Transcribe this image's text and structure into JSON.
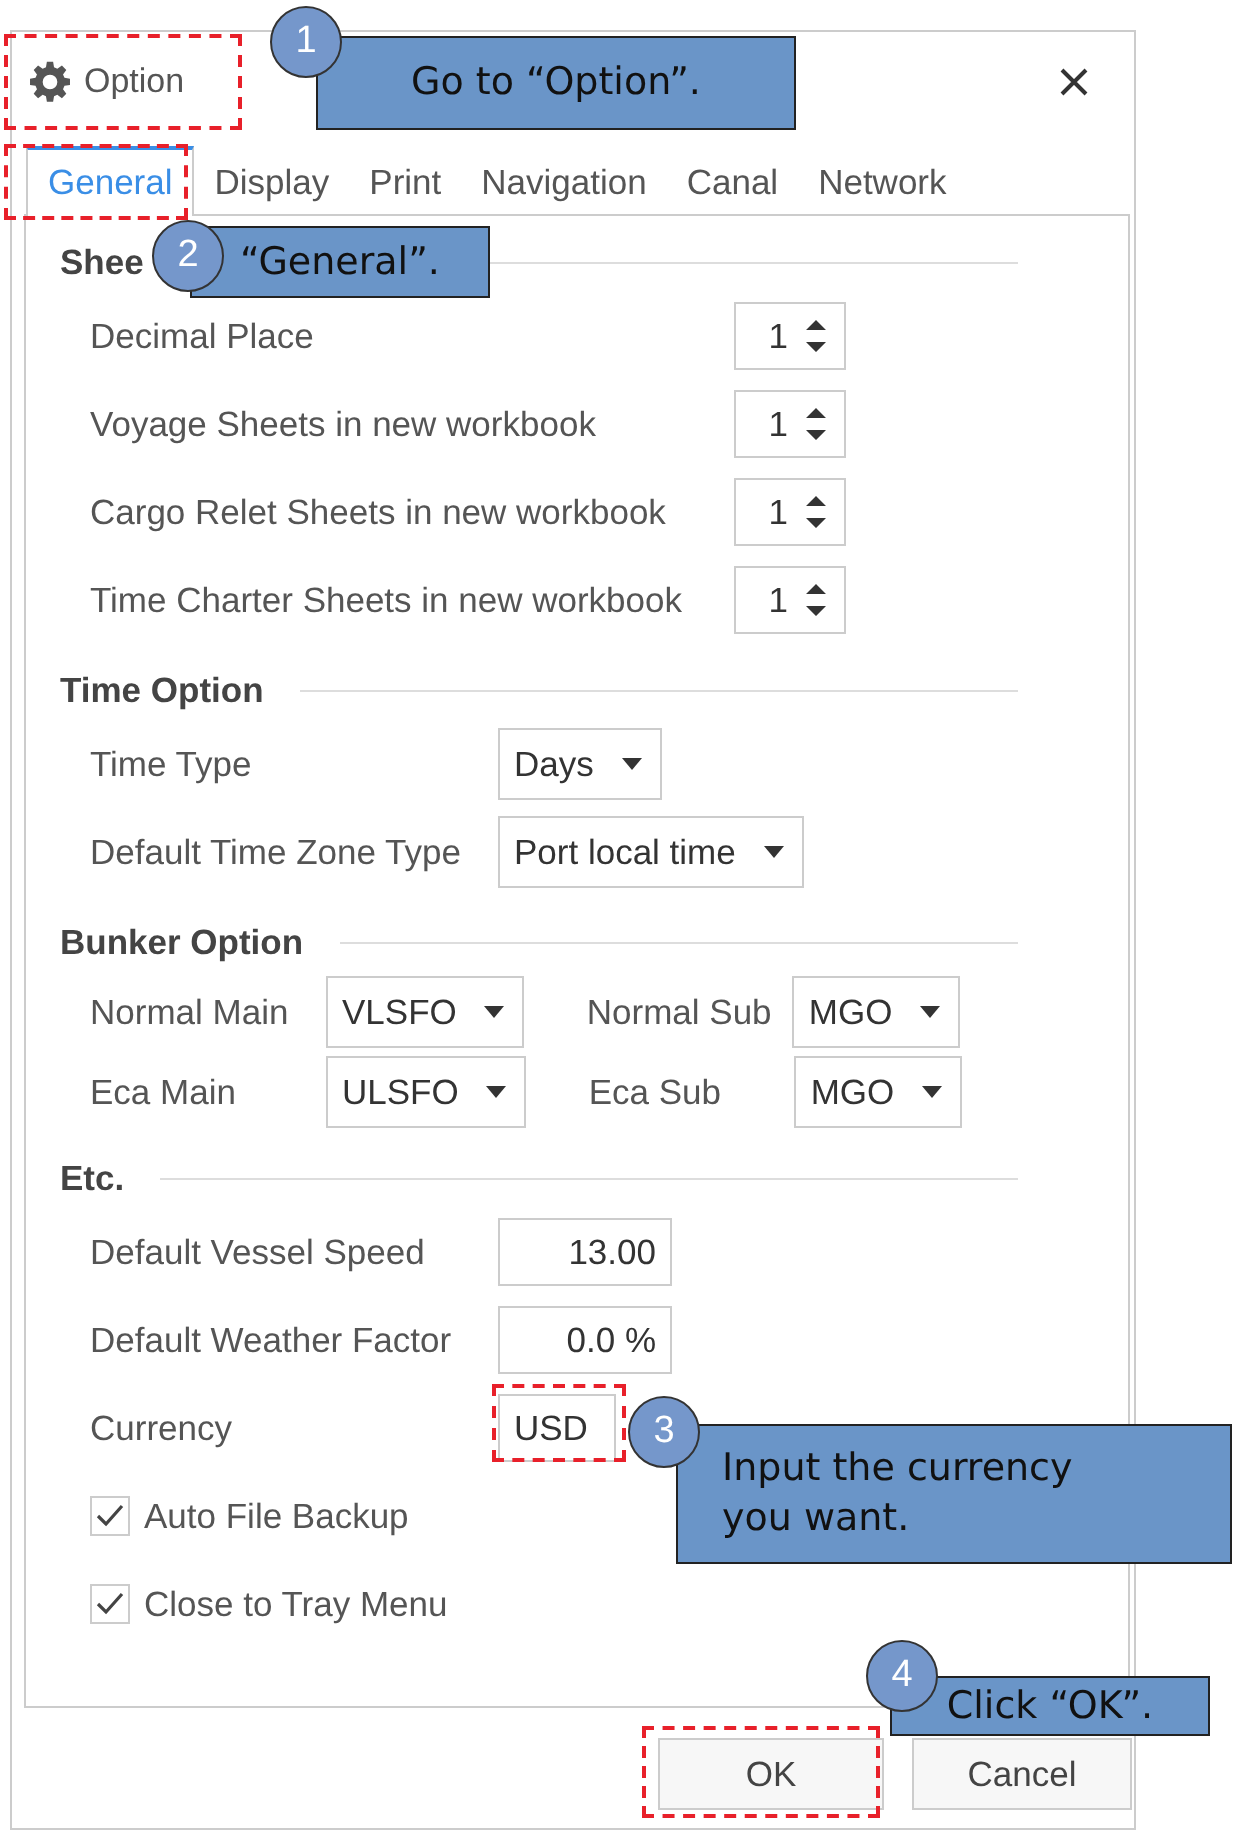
{
  "window": {
    "title": "Option"
  },
  "tabs": [
    {
      "label": "General",
      "selected": true
    },
    {
      "label": "Display",
      "selected": false
    },
    {
      "label": "Print",
      "selected": false
    },
    {
      "label": "Navigation",
      "selected": false
    },
    {
      "label": "Canal",
      "selected": false
    },
    {
      "label": "Network",
      "selected": false
    }
  ],
  "sections": [
    {
      "title": "Shee",
      "rows": [
        {
          "fields": [
            {
              "kind": "spinner",
              "label": "Decimal Place",
              "value": "1"
            }
          ]
        },
        {
          "fields": [
            {
              "kind": "spinner",
              "label": "Voyage Sheets in new workbook",
              "value": "1"
            }
          ]
        },
        {
          "fields": [
            {
              "kind": "spinner",
              "label": "Cargo Relet Sheets in new workbook",
              "value": "1"
            }
          ]
        },
        {
          "fields": [
            {
              "kind": "spinner",
              "label": "Time Charter Sheets in new workbook",
              "value": "1"
            }
          ]
        }
      ]
    },
    {
      "title": "Time Option",
      "rows": [
        {
          "fields": [
            {
              "kind": "dropdown",
              "label": "Time Type",
              "value": "Days"
            }
          ]
        },
        {
          "fields": [
            {
              "kind": "dropdown",
              "label": "Default Time Zone Type",
              "value": "Port local time"
            }
          ]
        }
      ]
    },
    {
      "title": "Bunker Option",
      "rows": [
        {
          "fields": [
            {
              "kind": "dropdown",
              "label": "Normal Main",
              "value": "VLSFO"
            },
            {
              "kind": "dropdown",
              "label": "Normal Sub",
              "value": "MGO"
            }
          ]
        },
        {
          "fields": [
            {
              "kind": "dropdown",
              "label": "Eca Main",
              "value": "ULSFO"
            },
            {
              "kind": "dropdown",
              "label": "Eca Sub",
              "value": "MGO"
            }
          ]
        }
      ]
    },
    {
      "title": "Etc.",
      "rows": [
        {
          "fields": [
            {
              "kind": "input",
              "label": "Default Vessel Speed",
              "value": "13.00"
            }
          ]
        },
        {
          "fields": [
            {
              "kind": "input",
              "label": "Default Weather Factor",
              "value": "0.0 %"
            }
          ]
        },
        {
          "fields": [
            {
              "kind": "text",
              "label": "Currency",
              "value": "USD"
            }
          ]
        },
        {
          "fields": [
            {
              "kind": "checkbox",
              "label": "Auto File Backup",
              "checked": true
            }
          ]
        },
        {
          "fields": [
            {
              "kind": "checkbox",
              "label": "Close to Tray Menu",
              "checked": true
            }
          ]
        }
      ]
    }
  ],
  "buttons": [
    {
      "label": "OK"
    },
    {
      "label": "Cancel"
    }
  ],
  "callouts": [
    {
      "number": "1",
      "text": "Go to “Option”."
    },
    {
      "number": "2",
      "text": "“General”."
    },
    {
      "number": "3",
      "text": "Input the currency you want."
    },
    {
      "number": "4",
      "text": "Click “OK”."
    }
  ]
}
